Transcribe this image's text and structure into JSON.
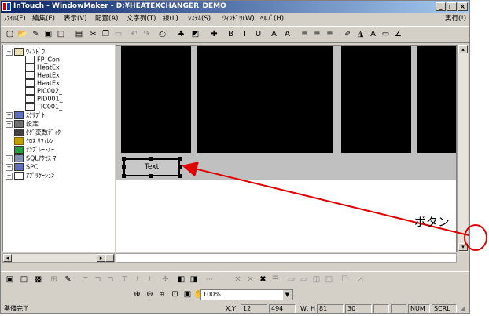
{
  "window": {
    "title": "InTouch - WindowMaker - D:¥HEATEXCHANGER_DEMO",
    "controls": [
      "_",
      "□",
      "×"
    ]
  },
  "menu": {
    "items": [
      "ﾌｧｲﾙ(F)",
      "編集(E)",
      "表示(V)",
      "配置(A)",
      "文字列(T)",
      "線(L)",
      "ｼｽﾃﾑ(S)",
      "ｳｨﾝﾄﾞｳ(W)",
      "ﾍﾙﾌﾟ(H)"
    ],
    "runtime": "実行(!)"
  },
  "tree": {
    "nodes": [
      {
        "label": "ｳｨﾝﾄﾞｳ",
        "expander": "−",
        "indent": 0,
        "icon": "window-folder-icon"
      },
      {
        "label": "FP_Con",
        "expander": "",
        "indent": 1,
        "icon": "window-icon"
      },
      {
        "label": "HeatEx",
        "expander": "",
        "indent": 1,
        "icon": "window-icon"
      },
      {
        "label": "HeatEx",
        "expander": "",
        "indent": 1,
        "icon": "window-icon"
      },
      {
        "label": "HeatEx",
        "expander": "",
        "indent": 1,
        "icon": "window-icon"
      },
      {
        "label": "PIC002_",
        "expander": "",
        "indent": 1,
        "icon": "window-icon"
      },
      {
        "label": "PID001_",
        "expander": "",
        "indent": 1,
        "icon": "window-icon"
      },
      {
        "label": "TIC001_",
        "expander": "",
        "indent": 1,
        "icon": "window-icon"
      },
      {
        "label": "ｽｸﾘﾌﾟﾄ",
        "expander": "+",
        "indent": 0,
        "icon": "script-icon"
      },
      {
        "label": "設定",
        "expander": "+",
        "indent": 0,
        "icon": "settings-icon"
      },
      {
        "label": "ﾀｸﾞ変数ﾃﾞｨｸ",
        "expander": "",
        "indent": 0,
        "icon": "tagname-dictionary-icon"
      },
      {
        "label": "ｸﾛｽ ﾘﾌｧﾚﾝ",
        "expander": "",
        "indent": 0,
        "icon": "cross-reference-icon"
      },
      {
        "label": "ﾃﾝﾌﾟﾚｰﾄﾒｰ",
        "expander": "",
        "indent": 0,
        "icon": "template-maker-icon"
      },
      {
        "label": "SQLｱｸｾｽ ﾏ",
        "expander": "+",
        "indent": 0,
        "icon": "sql-access-icon"
      },
      {
        "label": "SPC",
        "expander": "+",
        "indent": 0,
        "icon": "spc-icon"
      },
      {
        "label": "ｱﾌﾟﾘｹｰｼｮﾝ",
        "expander": "+",
        "indent": 0,
        "icon": "application-icon"
      }
    ]
  },
  "canvas": {
    "text_object": "Text"
  },
  "zoom": {
    "value": "100%"
  },
  "status": {
    "ready": "準備完了",
    "xy_label": "X,Y",
    "x": "12",
    "y": "494",
    "wh_label": "W, H",
    "w": "81",
    "h": "30",
    "num": "NUM",
    "scrl": "SCRL"
  },
  "annotation": {
    "label": "ボタン",
    "color": "#e00000"
  },
  "colors": {
    "titlebar_start": "#0a246a",
    "titlebar_end": "#a6caf0",
    "face": "#d4d0c8"
  }
}
